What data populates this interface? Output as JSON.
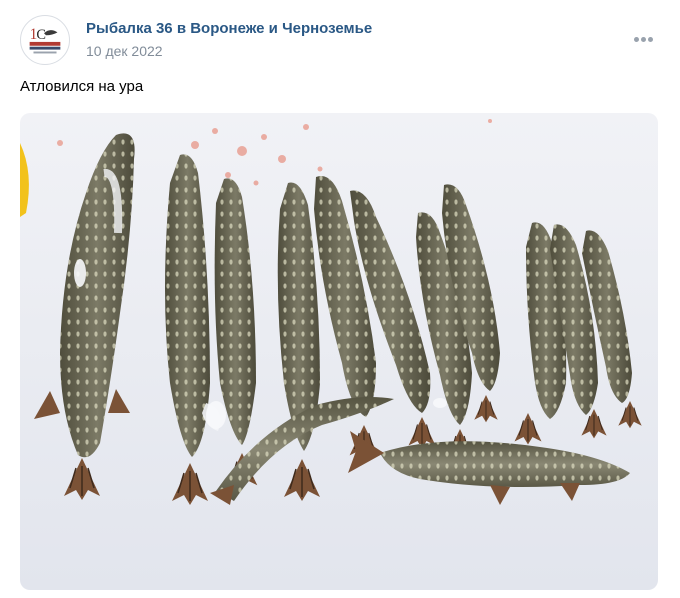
{
  "post": {
    "author": "Рыбалка 36 в Воронеже и Черноземье",
    "date": "10 дек 2022",
    "text": "Атловился на ура",
    "avatar": {
      "icon": "community-logo-icon"
    },
    "more_icon": "more-dots-icon",
    "photo": {
      "icon": "pike-catch-photo",
      "fish_count": 12
    }
  },
  "colors": {
    "author_link": "#2a5885",
    "date_text": "#818c99",
    "more_dots": "#99a2ad",
    "snow": "#e9ecf2",
    "fish_body": "#6d6a55",
    "fish_fin": "#8a5a3a"
  }
}
